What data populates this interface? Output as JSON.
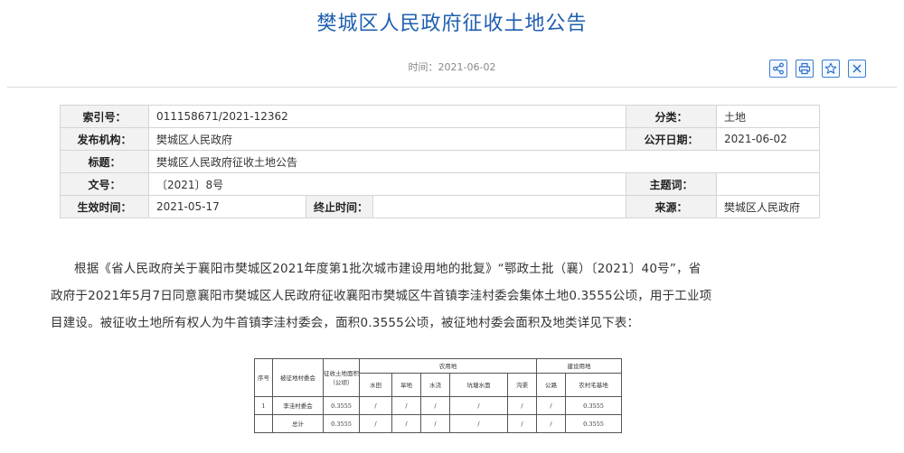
{
  "page": {
    "title": "樊城区人民政府征收土地公告",
    "date_prefix": "时间：",
    "date": "2021-06-02"
  },
  "toolbar": [
    {
      "name": "share",
      "icon": "share-icon",
      "color": "#2a6fc9"
    },
    {
      "name": "print",
      "icon": "print-icon",
      "color": "#2a6fc9"
    },
    {
      "name": "favorite",
      "icon": "star-icon",
      "color": "#2a6fc9"
    },
    {
      "name": "close",
      "icon": "close-icon",
      "color": "#2a6fc9"
    }
  ],
  "meta": {
    "index_label": "索引号：",
    "index_value": "011158671/2021-12362",
    "category_label": "分类：",
    "category_value": "土地",
    "publisher_label": "发布机构：",
    "publisher_value": "樊城区人民政府",
    "pubdate_label": "公开日期：",
    "pubdate_value": "2021-06-02",
    "title_label": "标题：",
    "title_value": "樊城区人民政府征收土地公告",
    "docno_label": "文号：",
    "docno_value": "〔2021〕8号",
    "subject_label": "主题词：",
    "subject_value": "",
    "effective_label": "生效时间：",
    "effective_value": "2021-05-17",
    "end_label": "终止时间：",
    "end_value": "",
    "source_label": "来源：",
    "source_value": "樊城区人民政府"
  },
  "body": {
    "line1": "根据《省人民政府关于襄阳市樊城区2021年度第1批次城市建设用地的批复》“鄂政土批（襄）〔2021〕40号”，省",
    "line2": "政府于2021年5月7日同意襄阳市樊城区人民政府征收襄阳市樊城区牛首镇李洼村委会集体土地0.3555公顷，用于工业项",
    "line3": "目建设。被征收土地所有权人为牛首镇李洼村委会，面积0.3555公顷，被征地村委会面积及地类详见下表："
  },
  "land_table": {
    "headers": {
      "seq": "序号",
      "village": "被征地村委会",
      "area": "征收土地面积（公顷）",
      "agri": "农用地",
      "construction": "建设用地"
    },
    "sub_headers": [
      "水田",
      "旱地",
      "水浇",
      "坑塘水面",
      "沟渠",
      "公路",
      "农村宅基地"
    ],
    "rows": [
      {
        "seq": "1",
        "village": "李洼村委会",
        "area": "0.3555",
        "cells": [
          "/",
          "/",
          "/",
          "/",
          "/",
          "/",
          "0.3555"
        ]
      },
      {
        "seq": "",
        "village": "总计",
        "area": "0.3555",
        "cells": [
          "/",
          "/",
          "/",
          "/",
          "/",
          "/",
          "0.3555"
        ]
      }
    ]
  }
}
